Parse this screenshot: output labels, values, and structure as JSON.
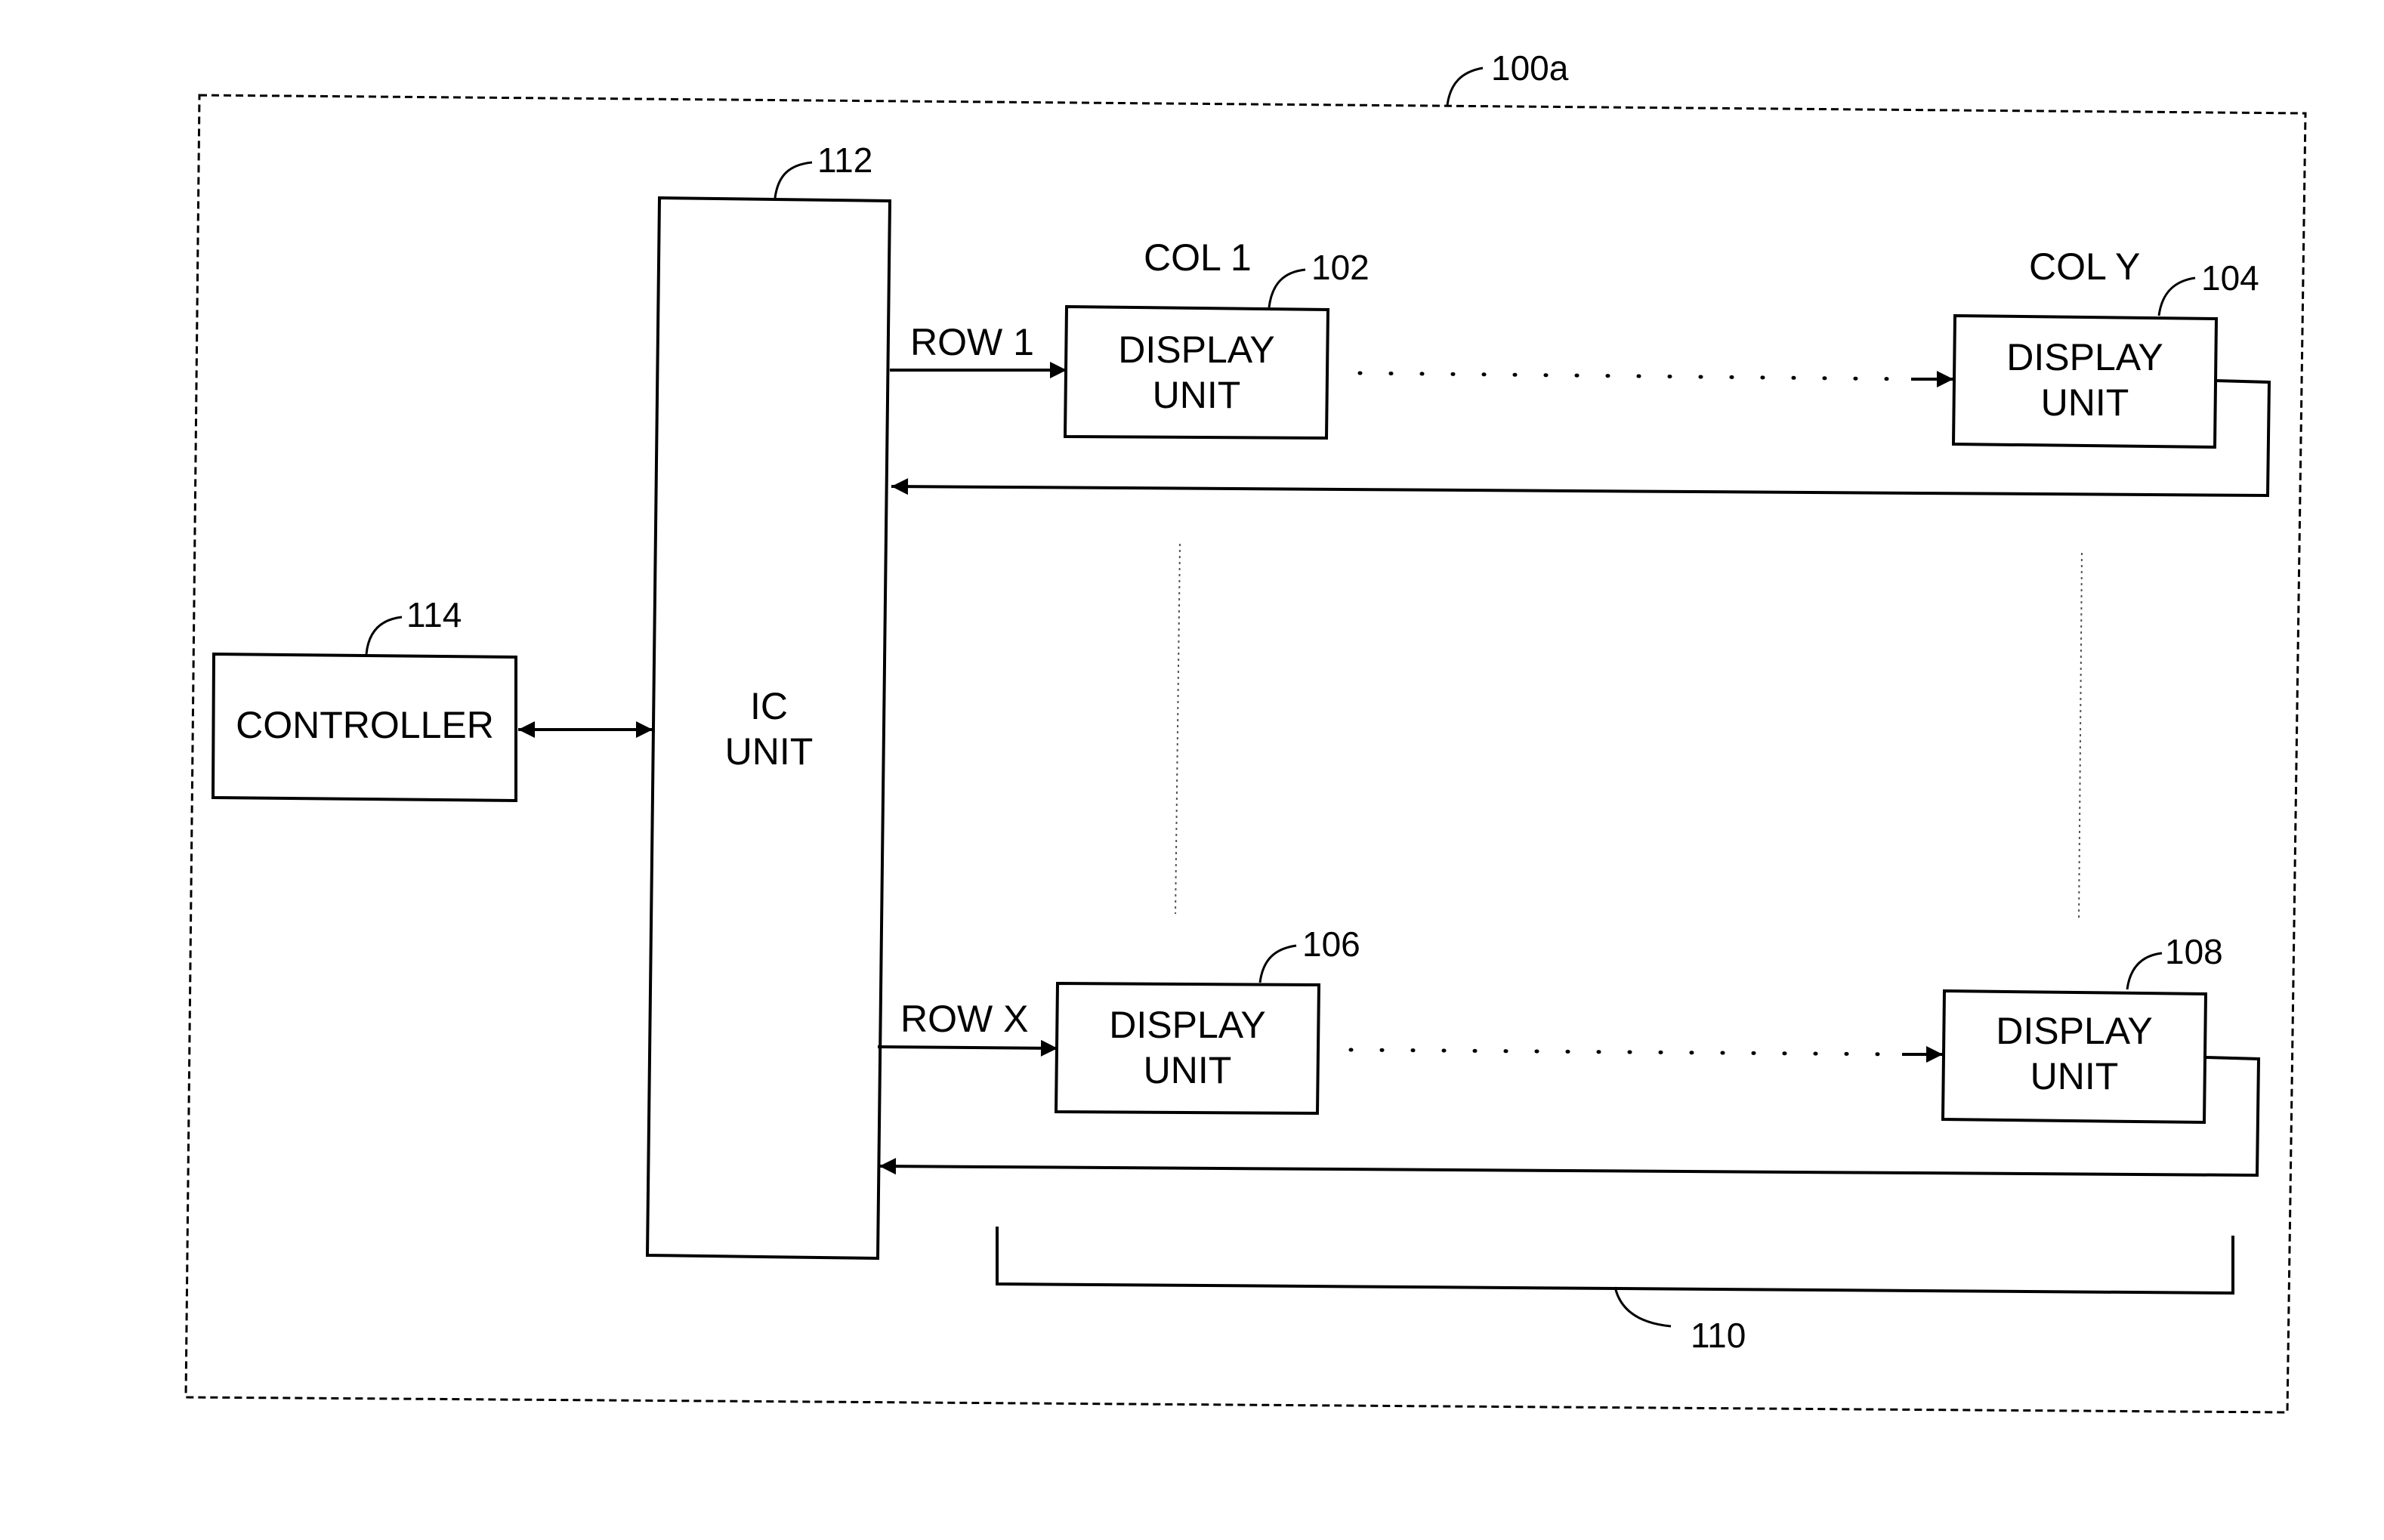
{
  "figure": {
    "ref": "100a"
  },
  "ic_unit": {
    "line1": "IC",
    "line2": "UNIT",
    "ref": "112"
  },
  "controller": {
    "label": "CONTROLLER",
    "ref": "114"
  },
  "display_units": [
    {
      "line1": "DISPLAY",
      "line2": "UNIT",
      "ref": "102",
      "column_label": "COL 1",
      "row_label": "ROW 1"
    },
    {
      "line1": "DISPLAY",
      "line2": "UNIT",
      "ref": "104",
      "column_label": "COL Y"
    },
    {
      "line1": "DISPLAY",
      "line2": "UNIT",
      "ref": "106",
      "row_label": "ROW X"
    },
    {
      "line1": "DISPLAY",
      "line2": "UNIT",
      "ref": "108"
    }
  ],
  "bracket": {
    "ref": "110"
  }
}
